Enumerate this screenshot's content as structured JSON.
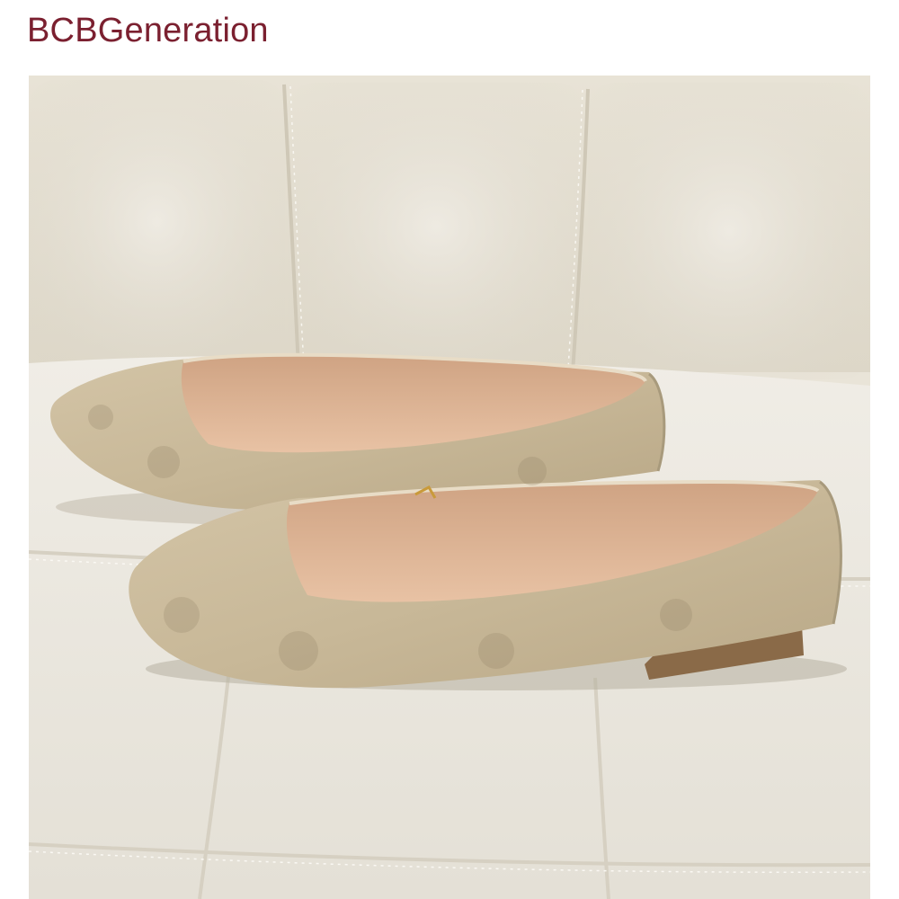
{
  "header": {
    "brand_label": "BCBGeneration"
  },
  "product_image": {
    "icon": "product-photo"
  },
  "colors": {
    "brand": "#7b2030",
    "background": "#ffffff"
  }
}
